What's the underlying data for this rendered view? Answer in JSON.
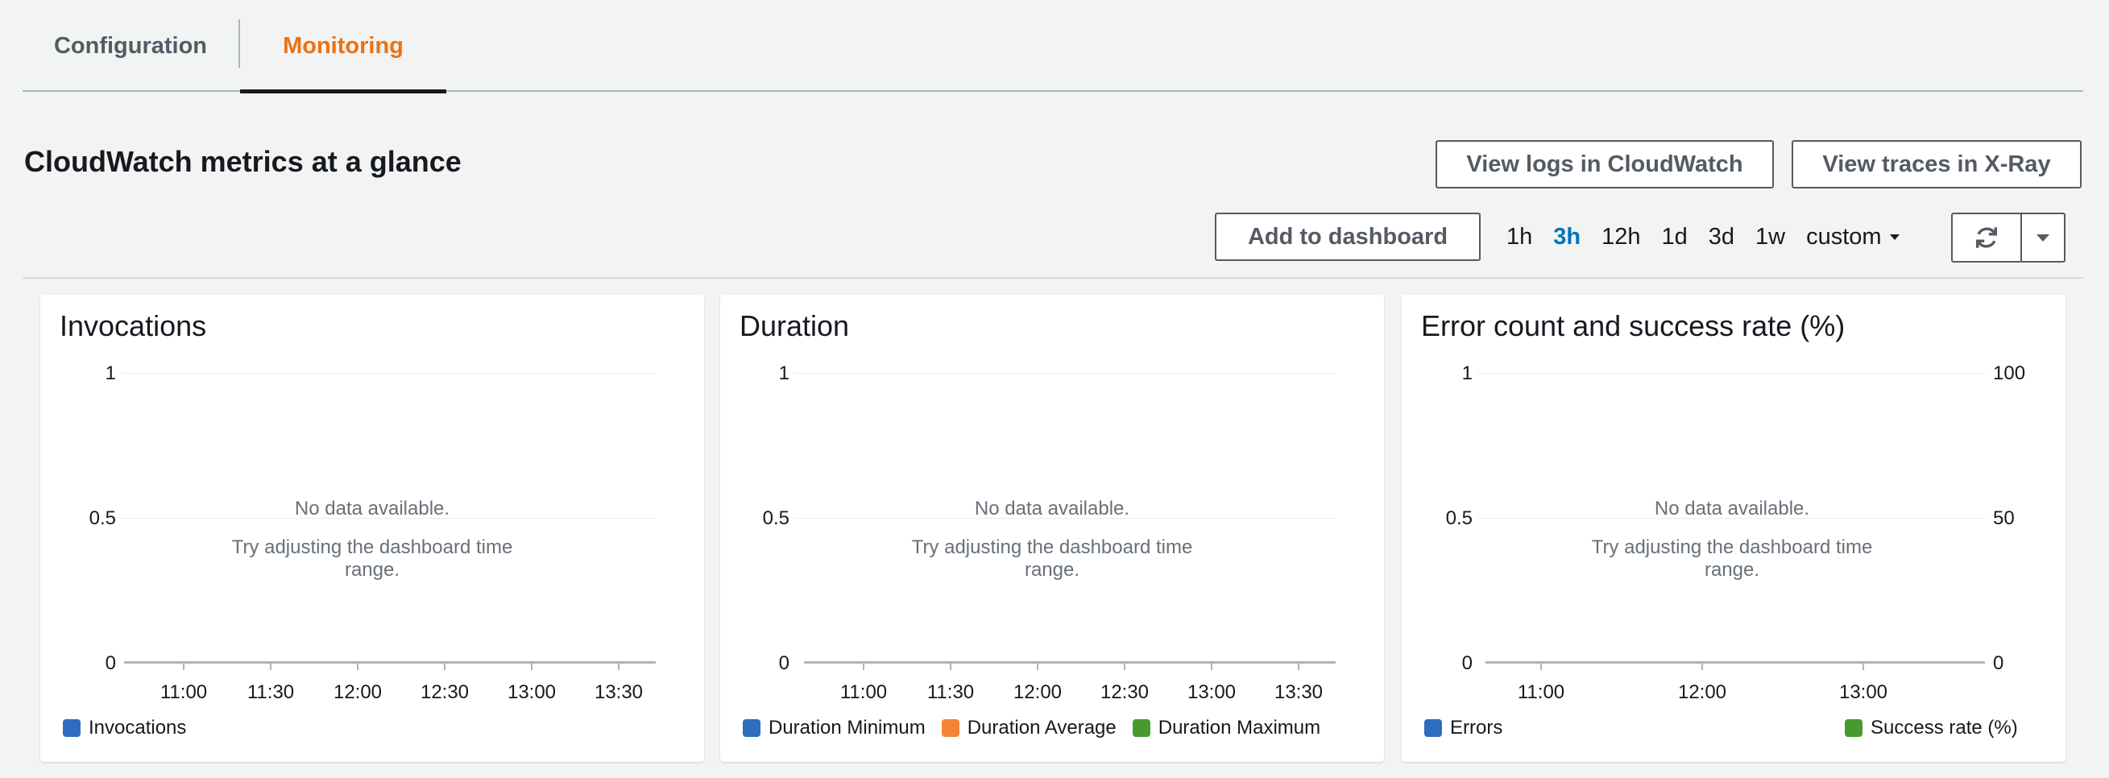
{
  "tabs": [
    {
      "label": "Configuration",
      "active": false
    },
    {
      "label": "Monitoring",
      "active": true
    }
  ],
  "header": {
    "title": "CloudWatch metrics at a glance",
    "view_logs_label": "View logs in CloudWatch",
    "view_traces_label": "View traces in X-Ray",
    "add_dashboard_label": "Add to dashboard",
    "time_ranges": [
      "1h",
      "3h",
      "12h",
      "1d",
      "3d",
      "1w"
    ],
    "selected_range": "3h",
    "custom_label": "custom"
  },
  "colors": {
    "accent_tab": "#ec7211",
    "active_range": "#0073bb",
    "series_blue": "#2e6cbf",
    "series_orange": "#f58536",
    "series_green": "#479a2f"
  },
  "charts": [
    {
      "title": "Invocations",
      "y_ticks": [
        "1",
        "0.5",
        "0"
      ],
      "x_ticks": [
        "11:00",
        "11:30",
        "12:00",
        "12:30",
        "13:00",
        "13:30"
      ],
      "no_data": "No data available.",
      "hint": "Try adjusting the dashboard time range.",
      "legend": [
        "Invocations"
      ]
    },
    {
      "title": "Duration",
      "y_ticks": [
        "1",
        "0.5",
        "0"
      ],
      "x_ticks": [
        "11:00",
        "11:30",
        "12:00",
        "12:30",
        "13:00",
        "13:30"
      ],
      "no_data": "No data available.",
      "hint": "Try adjusting the dashboard time range.",
      "legend": [
        "Duration Minimum",
        "Duration Average",
        "Duration Maximum"
      ]
    },
    {
      "title": "Error count and success rate (%)",
      "y_ticks": [
        "1",
        "0.5",
        "0"
      ],
      "y_ticks_right": [
        "100",
        "50",
        "0"
      ],
      "x_ticks": [
        "11:00",
        "12:00",
        "13:00"
      ],
      "no_data": "No data available.",
      "hint": "Try adjusting the dashboard time range.",
      "legend": [
        "Errors",
        "Success rate (%)"
      ]
    }
  ]
}
